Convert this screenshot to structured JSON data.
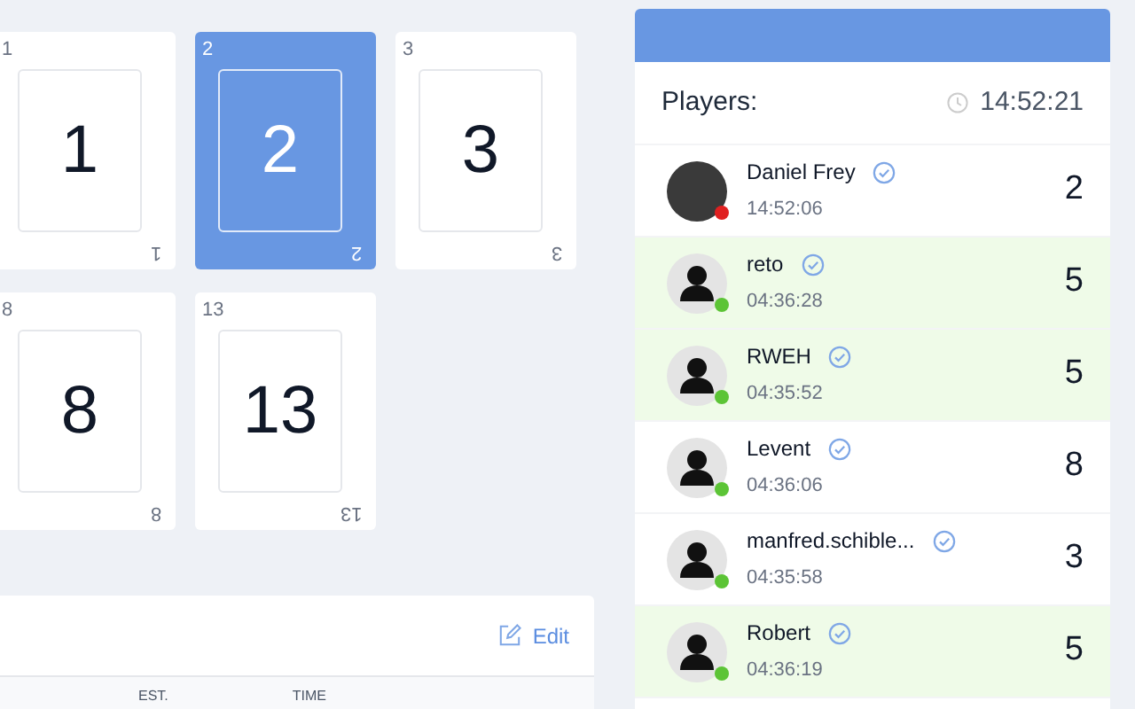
{
  "cards": [
    {
      "label": "1",
      "value": "1",
      "corner_label": "1",
      "selected": false
    },
    {
      "label": "2",
      "value": "2",
      "corner_label": "2",
      "selected": true
    },
    {
      "label": "3",
      "value": "3",
      "corner_label": "3",
      "selected": false
    },
    {
      "label": "8",
      "value": "8",
      "corner_label": "8",
      "selected": false
    },
    {
      "label": "13",
      "value": "13",
      "corner_label": "13",
      "selected": false
    }
  ],
  "story_panel": {
    "edit_label": "Edit",
    "columns": [
      "EST.",
      "TIME"
    ]
  },
  "players_panel": {
    "title": "Players:",
    "clock": "14:52:21",
    "players": [
      {
        "name": "Daniel Frey",
        "time": "14:52:06",
        "estimate": "2",
        "kind": "photo",
        "color": "#e02020",
        "highlighted": false
      },
      {
        "name": "reto",
        "time": "04:36:28",
        "estimate": "5",
        "kind": "generic",
        "color": "#5cc436",
        "highlighted": true
      },
      {
        "name": "RWEH",
        "time": "04:35:52",
        "estimate": "5",
        "kind": "generic",
        "color": "#5cc436",
        "highlighted": true
      },
      {
        "name": "Levent",
        "time": "04:36:06",
        "estimate": "8",
        "kind": "generic",
        "color": "#5cc436",
        "highlighted": false
      },
      {
        "name": "manfred.schible...",
        "time": "04:35:58",
        "estimate": "3",
        "kind": "generic",
        "color": "#5cc436",
        "highlighted": false
      },
      {
        "name": "Robert",
        "time": "04:36:19",
        "estimate": "5",
        "kind": "generic",
        "color": "#5cc436",
        "highlighted": true
      }
    ]
  }
}
